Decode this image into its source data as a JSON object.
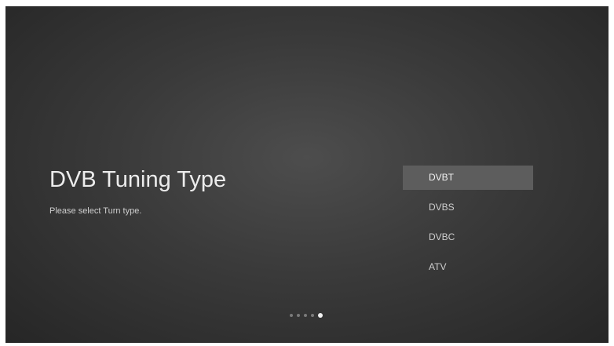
{
  "screen": {
    "title": "DVB Tuning Type",
    "subtitle": "Please select Turn type."
  },
  "options": [
    {
      "label": "DVBT",
      "selected": true
    },
    {
      "label": "DVBS",
      "selected": false
    },
    {
      "label": "DVBC",
      "selected": false
    },
    {
      "label": "ATV",
      "selected": false
    }
  ],
  "pager": {
    "total": 5,
    "current": 5
  }
}
